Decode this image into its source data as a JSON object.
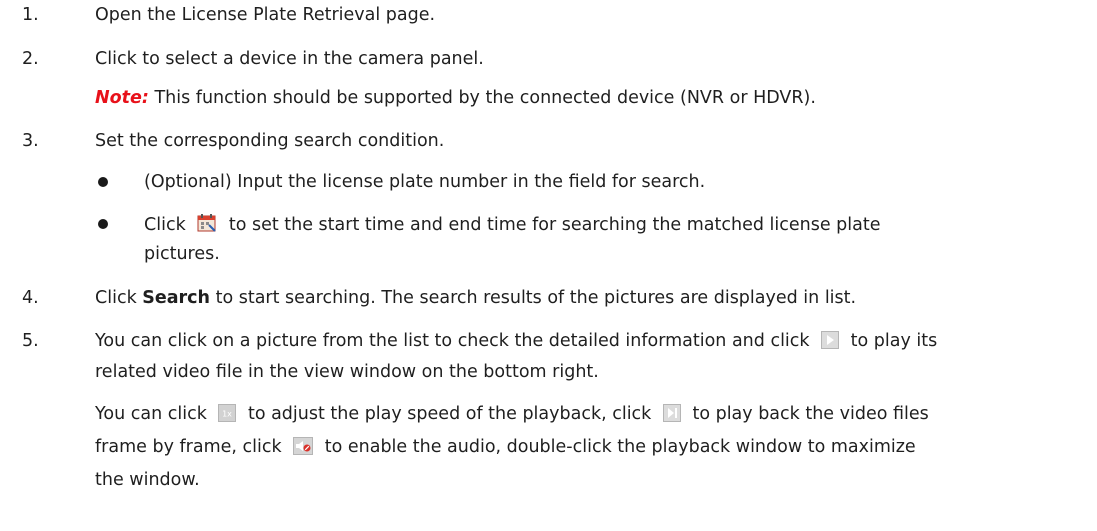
{
  "steps": [
    {
      "num": "1.",
      "text": "Open the License Plate Retrieval page."
    },
    {
      "num": "2.",
      "text": "Click to select a device in the camera panel."
    },
    {
      "note_label": "Note:",
      "note_text": " This function should be supported by the connected device (NVR or HDVR)."
    },
    {
      "num": "3.",
      "text": "Set the corresponding search condition."
    },
    {
      "num": "4.",
      "pre": "Click ",
      "bold": "Search",
      "post": " to start searching. The search results of the pictures are displayed in list."
    },
    {
      "num": "5.",
      "pre": "You can click on a picture from the list to check the detailed information and click ",
      "post": " to play its",
      "cont": "related video file in the view window on the bottom right."
    }
  ],
  "bullets": [
    {
      "text": "(Optional) Input the license plate number in the field for search."
    },
    {
      "pre": "Click ",
      "post": " to set the start time and end time for searching the matched license plate",
      "cont": "pictures."
    }
  ],
  "extra": {
    "p1": "You can click ",
    "p2": " to adjust the play speed of the playback, click ",
    "p3": " to play back the video files",
    "p4": "frame by frame, click ",
    "p5": " to enable the audio, double-click the playback window to maximize",
    "p6": "the window."
  },
  "icons": {
    "calendar": "calendar-icon",
    "play": "play-icon",
    "speed": "speed-1x-icon",
    "frame": "frame-by-frame-icon",
    "audio": "audio-icon"
  }
}
